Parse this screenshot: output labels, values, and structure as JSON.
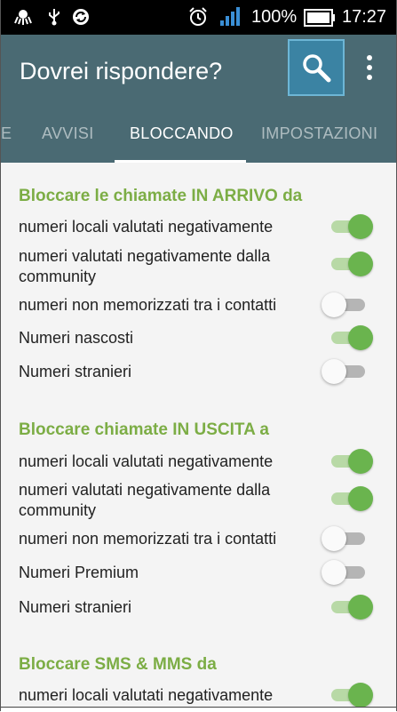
{
  "status_bar": {
    "battery_percent": "100%",
    "time": "17:27",
    "icons": [
      "octopus-icon",
      "usb-icon",
      "sync-icon",
      "alarm-icon",
      "signal-icon",
      "battery-icon"
    ]
  },
  "app_bar": {
    "title": "Dovrei rispondere?",
    "search_icon": "search-icon",
    "overflow_icon": "more-vert-icon"
  },
  "tabs": [
    {
      "label": "E",
      "active": false
    },
    {
      "label": "AVVISI",
      "active": false
    },
    {
      "label": "BLOCCANDO",
      "active": true
    },
    {
      "label": "IMPOSTAZIONI",
      "active": false
    }
  ],
  "sections": [
    {
      "title": "Bloccare le chiamate IN ARRIVO da",
      "items": [
        {
          "label": "numeri locali valutati negativamente",
          "enabled": true
        },
        {
          "label": "numeri valutati negativamente dalla community",
          "enabled": true
        },
        {
          "label": "numeri non memorizzati tra i contatti",
          "enabled": false
        },
        {
          "label": "Numeri nascosti",
          "enabled": true
        },
        {
          "label": "Numeri stranieri",
          "enabled": false
        }
      ]
    },
    {
      "title": "Bloccare chiamate IN USCITA a",
      "items": [
        {
          "label": "numeri locali valutati negativamente",
          "enabled": true
        },
        {
          "label": "numeri valutati negativamente dalla community",
          "enabled": true
        },
        {
          "label": "numeri non memorizzati tra i contatti",
          "enabled": false
        },
        {
          "label": "Numeri Premium",
          "enabled": false
        },
        {
          "label": "Numeri stranieri",
          "enabled": true
        }
      ]
    },
    {
      "title": "Bloccare SMS & MMS da",
      "items": [
        {
          "label": "numeri locali valutati negativamente",
          "enabled": true
        }
      ]
    }
  ],
  "colors": {
    "app_bar": "#4a6a73",
    "accent_green": "#7cad45",
    "toggle_on": "#6ab44e",
    "search_highlight": "#3b83a3"
  }
}
